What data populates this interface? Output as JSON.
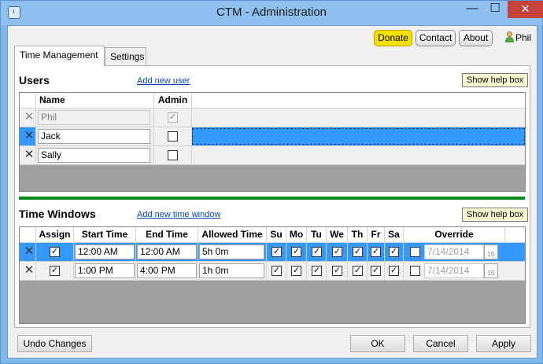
{
  "window": {
    "title": "CTM - Administration"
  },
  "titlebar": {
    "minimize": "—",
    "maximize": "☐",
    "close": "✕"
  },
  "top": {
    "donate_label": "Donate",
    "contact_label": "Contact",
    "about_label": "About",
    "user_name": "Phil"
  },
  "tabs": [
    {
      "label": "Time Management",
      "active": true
    },
    {
      "label": "Settings",
      "active": false
    }
  ],
  "users": {
    "title": "Users",
    "add_link": "Add new user",
    "help_button": "Show help box",
    "columns": [
      "Name",
      "Admin"
    ],
    "rows": [
      {
        "name": "Phil",
        "admin": true,
        "state": "disabled"
      },
      {
        "name": "Jack",
        "admin": false,
        "state": "selected"
      },
      {
        "name": "Sally",
        "admin": false,
        "state": "normal"
      }
    ]
  },
  "time_windows": {
    "title": "Time Windows",
    "add_link": "Add new time window",
    "help_button": "Show help box",
    "columns": [
      "Assign",
      "Start Time",
      "End Time",
      "Allowed Time",
      "Su",
      "Mo",
      "Tu",
      "We",
      "Th",
      "Fr",
      "Sa",
      "Override"
    ],
    "rows": [
      {
        "assign": true,
        "start": "12:00 AM",
        "end": "12:00 AM",
        "allowed": "5h 0m",
        "days": [
          true,
          true,
          true,
          true,
          true,
          true,
          true
        ],
        "override": false,
        "override_date": "7/14/2014",
        "cal_day": "15",
        "state": "selected"
      },
      {
        "assign": true,
        "start": "1:00 PM",
        "end": "4:00 PM",
        "allowed": "1h 0m",
        "days": [
          true,
          true,
          true,
          true,
          true,
          true,
          true
        ],
        "override": false,
        "override_date": "7/14/2014",
        "cal_day": "15",
        "state": "normal"
      }
    ]
  },
  "footer": {
    "undo_label": "Undo Changes",
    "ok_label": "OK",
    "cancel_label": "Cancel",
    "apply_label": "Apply"
  },
  "colors": {
    "accent": "#3399ff",
    "donate": "#f5e000",
    "divider": "#0b8a1c",
    "close": "#c7423a"
  }
}
